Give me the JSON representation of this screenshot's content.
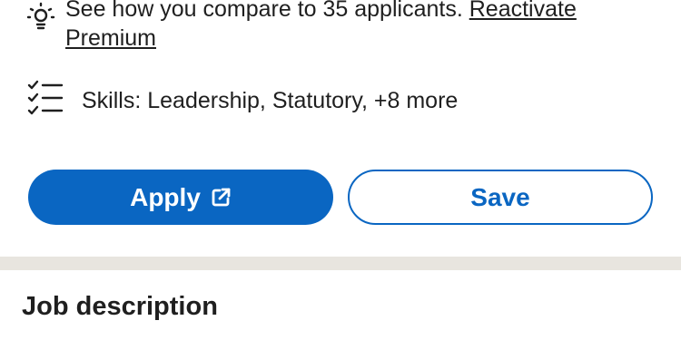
{
  "insight": {
    "text": "See how you compare to 35 applicants.",
    "link_line1": "Reactivate",
    "link_line2": "Premium",
    "icon": "lightbulb-icon"
  },
  "skills": {
    "text": "Skills: Leadership, Statutory, +8 more",
    "icon": "checklist-icon"
  },
  "actions": {
    "apply_label": "Apply",
    "apply_icon": "external-link-icon",
    "save_label": "Save"
  },
  "section": {
    "title": "Job description"
  },
  "colors": {
    "primary": "#0a66c2",
    "divider": "#e8e5df",
    "text": "#1f1f1f"
  }
}
